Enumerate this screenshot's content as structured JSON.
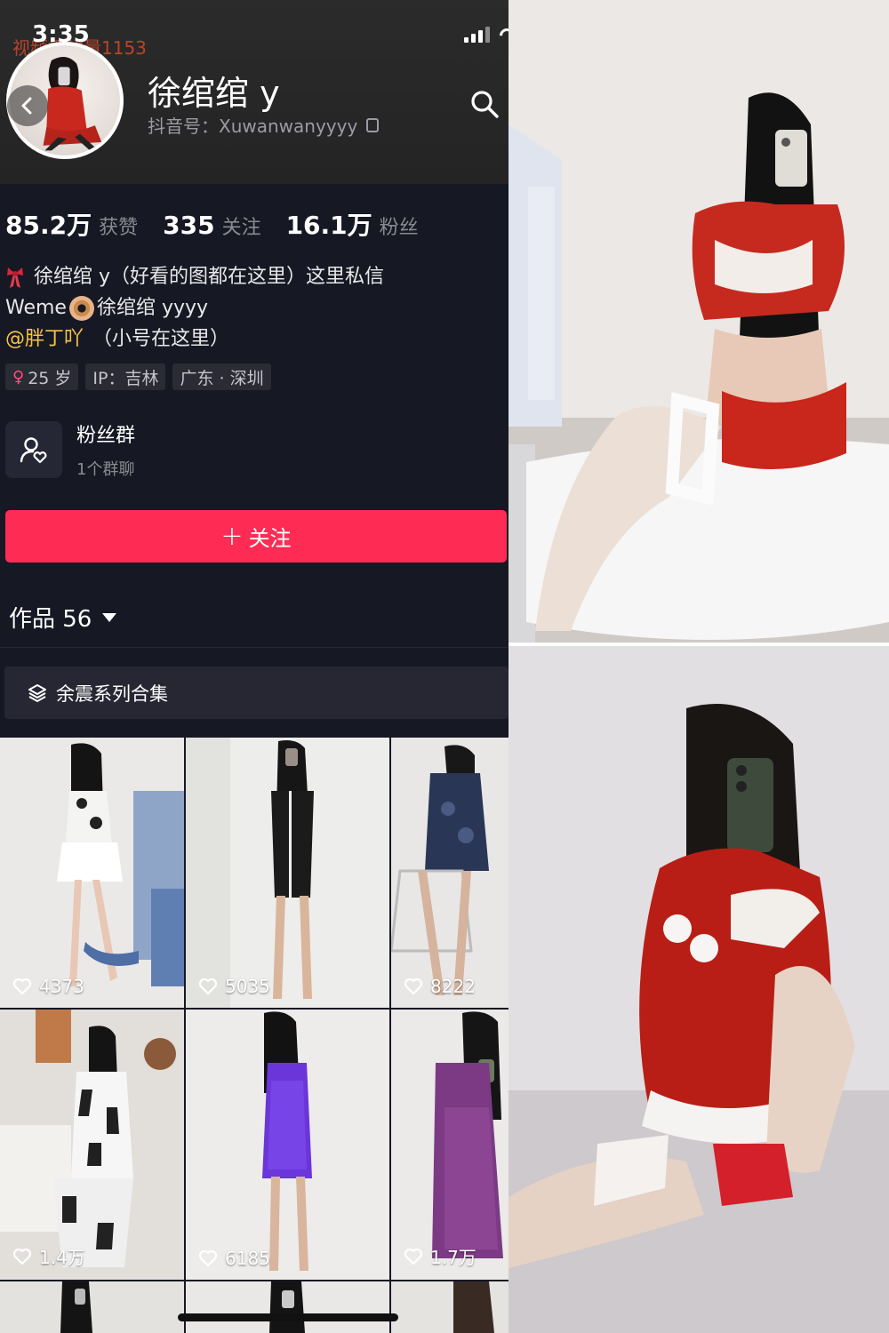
{
  "status_bar": {
    "time": "3:35",
    "overlay_text": "视频播放量1153"
  },
  "profile": {
    "name": "徐绾绾 y",
    "handle_label": "抖音号：Xuwanwanyyyy",
    "stats": [
      {
        "value": "85.2万",
        "label": "获赞"
      },
      {
        "value": "335",
        "label": "关注"
      },
      {
        "value": "16.1万",
        "label": "粉丝"
      }
    ],
    "bio": {
      "line1": "徐绾绾 y（好看的图都在这里）这里私信",
      "line2_prefix": "Weme",
      "line2_suffix": "徐绾绾 yyyy",
      "line3_mention": "@胖丁吖",
      "line3_rest": "（小号在这里）"
    },
    "tags": {
      "age": "25 岁",
      "ip": "IP：吉林",
      "location": "广东 · 深圳"
    },
    "fan_group": {
      "title": "粉丝群",
      "subtitle": "1个群聊"
    },
    "follow_label": "关注"
  },
  "works": {
    "label": "作品 56",
    "collection_label": "余震系列合集",
    "items": [
      {
        "likes": "4373"
      },
      {
        "likes": "5035"
      },
      {
        "likes": "8222"
      },
      {
        "likes": "1.4万"
      },
      {
        "likes": "6185"
      },
      {
        "likes": "1.7万"
      }
    ]
  },
  "colors": {
    "background": "#161823",
    "follow_button": "#fe2c55",
    "mention": "#f7c34c",
    "accent_red": "#c8281e"
  },
  "icons": [
    "back-icon",
    "search-icon",
    "copy-icon",
    "female-icon",
    "fan-group-icon",
    "plus-icon",
    "caret-down-icon",
    "layers-icon",
    "heart-icon"
  ]
}
